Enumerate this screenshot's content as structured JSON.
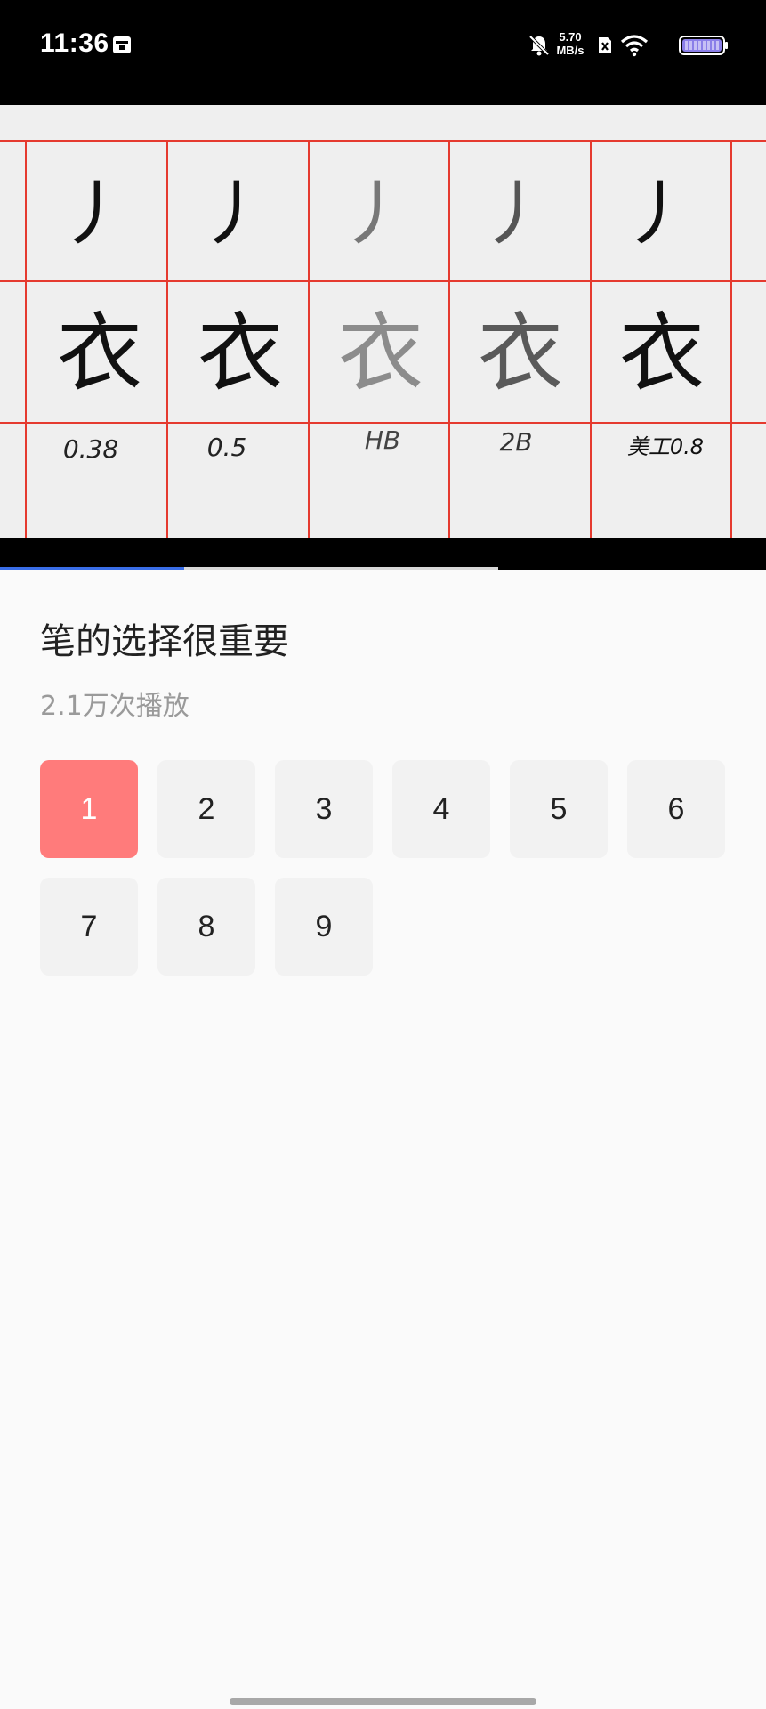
{
  "status_bar": {
    "time": "11:36",
    "net_speed_value": "5.70",
    "net_speed_unit": "MB/s",
    "icons": [
      "calendar-icon",
      "bell-off-icon",
      "sim-x-icon",
      "wifi-icon",
      "battery-icon"
    ]
  },
  "video": {
    "grid": {
      "stroke_row": [
        "丿",
        "丿",
        "丿",
        "丿",
        "丿"
      ],
      "char_row": [
        "衣",
        "衣",
        "衣",
        "衣",
        "衣"
      ],
      "label_row": [
        "0.38",
        "0.5",
        "HB",
        "2B",
        "美工0.8"
      ]
    },
    "progress": {
      "played": 0.24,
      "buffered": 0.65
    },
    "colors": {
      "grid_line": "#e53a2f",
      "progress": "#3a6ee8"
    }
  },
  "info": {
    "title": "笔的选择很重要",
    "plays": "2.1万次播放"
  },
  "episodes": {
    "items": [
      "1",
      "2",
      "3",
      "4",
      "5",
      "6",
      "7",
      "8",
      "9"
    ],
    "selected": "1",
    "colors": {
      "selected_bg": "#ff7b7b",
      "default_bg": "#f2f2f2"
    }
  }
}
